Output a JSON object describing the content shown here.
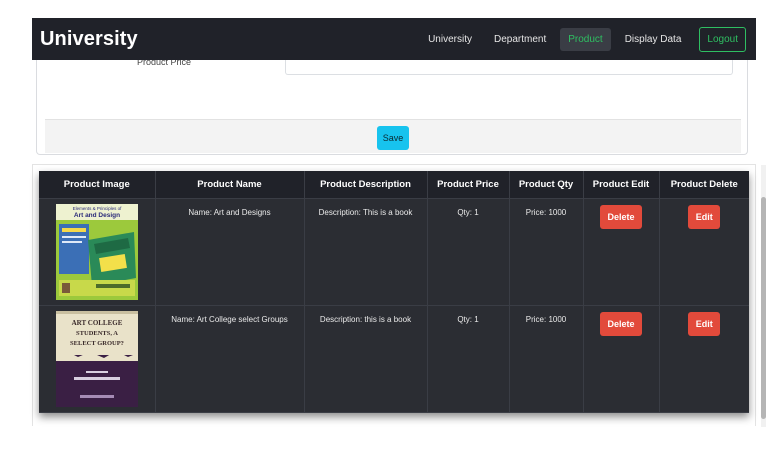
{
  "navbar": {
    "brand": "University",
    "links": [
      "University",
      "Department",
      "Product",
      "Display Data"
    ],
    "active_link": "Product",
    "logout_label": "Logout"
  },
  "form": {
    "price_label": "Product Price",
    "price_value": "",
    "save_label": "Save"
  },
  "table": {
    "headers": [
      "Product Image",
      "Product Name",
      "Product Description",
      "Product Price",
      "Product Qty",
      "Product Edit",
      "Product Delete"
    ],
    "rows": [
      {
        "image": "book-cover-art-and-design",
        "name": "Name: Art and Designs",
        "description": "Description: This is a book",
        "price_col": "Qty: 1",
        "qty_col": "Price: 1000",
        "edit_col_label": "Delete",
        "delete_col_label": "Edit",
        "cover_title": "Elements & Principles of Art and Design"
      },
      {
        "image": "book-cover-art-college",
        "name": "Name: Art College select Groups",
        "description": "Description: this is a book",
        "price_col": "Qty: 1",
        "qty_col": "Price: 1000",
        "edit_col_label": "Delete",
        "delete_col_label": "Edit",
        "cover_title": "Art College Students, A Select Group?"
      }
    ]
  },
  "colors": {
    "navbar_bg": "#202229",
    "table_bg": "#202229",
    "accent_green": "#2fbf62",
    "save_button": "#17c3ee",
    "action_button": "#e24a3b"
  }
}
